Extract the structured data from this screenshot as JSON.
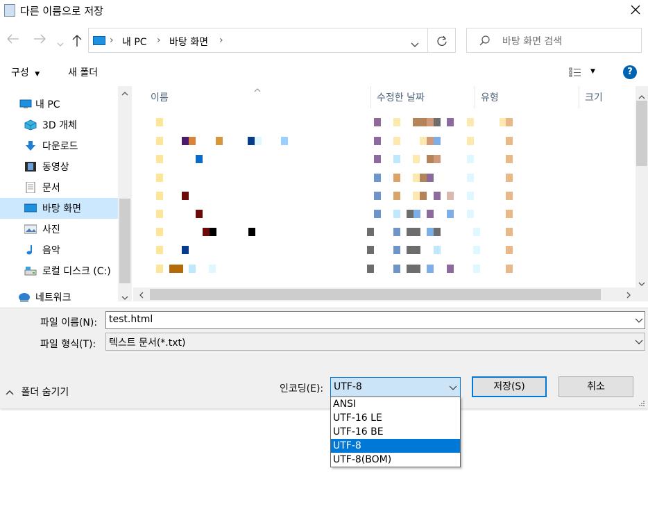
{
  "window": {
    "title": "다른 이름으로 저장",
    "close_icon": "close-icon"
  },
  "address": {
    "crumbs": [
      "내 PC",
      "바탕 화면"
    ]
  },
  "search": {
    "placeholder": "바탕 화면 검색"
  },
  "toolbar": {
    "organize": "구성",
    "new_folder": "새 폴더",
    "help": "?"
  },
  "nav_pane": {
    "items": [
      {
        "label": "내 PC",
        "icon": "pc-icon"
      },
      {
        "label": "3D 개체",
        "icon": "cube-icon"
      },
      {
        "label": "다운로드",
        "icon": "download-arrow-icon"
      },
      {
        "label": "동영상",
        "icon": "film-icon"
      },
      {
        "label": "문서",
        "icon": "document-icon"
      },
      {
        "label": "바탕 화면",
        "icon": "desktop-icon",
        "selected": true
      },
      {
        "label": "사진",
        "icon": "picture-icon"
      },
      {
        "label": "음악",
        "icon": "music-note-icon"
      },
      {
        "label": "로컬 디스크 (C:)",
        "icon": "drive-icon"
      },
      {
        "label": "네트워크",
        "icon": "network-icon"
      }
    ]
  },
  "file_list": {
    "columns": [
      "이름",
      "수정한 날짜",
      "유형",
      "크기"
    ]
  },
  "form": {
    "filename_label": "파일 이름(N):",
    "filename_value": "test.html",
    "filetype_label": "파일 형식(T):",
    "filetype_value": "텍스트 문서(*.txt)",
    "hide_folders": "폴더 숨기기",
    "encoding_label": "인코딩(E):",
    "encoding_value": "UTF-8",
    "save": "저장(S)",
    "cancel": "취소"
  },
  "encoding_options": {
    "items": [
      "ANSI",
      "UTF-16 LE",
      "UTF-16 BE",
      "UTF-8",
      "UTF-8(BOM)"
    ],
    "selected": "UTF-8"
  },
  "colors": {
    "accent": "#0078d7",
    "selected_nav": "#cce8ff",
    "panel": "#f0f0f0"
  }
}
